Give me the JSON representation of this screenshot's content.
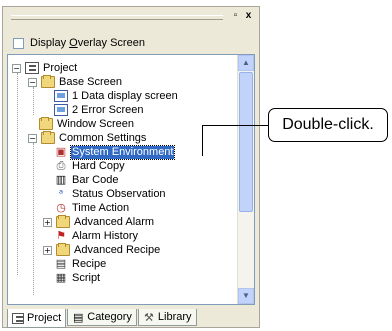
{
  "window": {
    "restore_glyph": "▫",
    "close_glyph": "x"
  },
  "overlay": {
    "label_pre": "Display ",
    "label_accel": "O",
    "label_post": "verlay Screen",
    "checked": false
  },
  "tree": {
    "root": "Project",
    "items": [
      {
        "label": "Base Screen",
        "icon": "folder-icon"
      },
      {
        "label": "1 Data display screen",
        "icon": "screen-icon"
      },
      {
        "label": "2 Error Screen",
        "icon": "screen-icon"
      },
      {
        "label": "Window Screen",
        "icon": "folder-icon"
      },
      {
        "label": "Common Settings",
        "icon": "folder-icon"
      },
      {
        "label": "System Environment",
        "icon": "system-environment-icon",
        "selected": true
      },
      {
        "label": "Hard Copy",
        "icon": "printer-icon"
      },
      {
        "label": "Bar Code",
        "icon": "barcode-icon"
      },
      {
        "label": "Status Observation",
        "icon": "status-observation-icon"
      },
      {
        "label": "Time Action",
        "icon": "clock-icon"
      },
      {
        "label": "Advanced Alarm",
        "icon": "folder-icon"
      },
      {
        "label": "Alarm History",
        "icon": "alarm-history-icon"
      },
      {
        "label": "Advanced Recipe",
        "icon": "folder-icon"
      },
      {
        "label": "Recipe",
        "icon": "recipe-icon"
      },
      {
        "label": "Script",
        "icon": "script-icon"
      }
    ]
  },
  "tabs": [
    {
      "label": "Project",
      "icon": "project-icon",
      "active": true
    },
    {
      "label": "Category",
      "icon": "category-icon",
      "active": false
    },
    {
      "label": "Library",
      "icon": "library-icon",
      "active": false
    }
  ],
  "callout": {
    "text": "Double-click."
  },
  "colors": {
    "selection": "#316ac5",
    "panel": "#ece9d8",
    "scrollbar": "#c1d3fb"
  }
}
